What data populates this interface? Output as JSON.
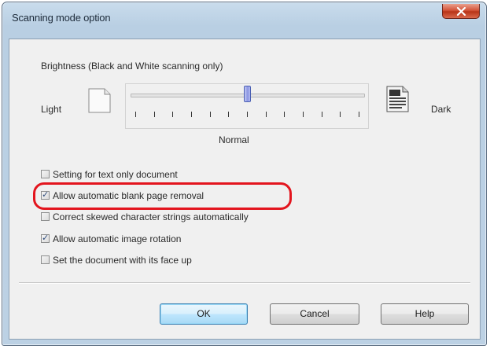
{
  "window": {
    "title": "Scanning mode option"
  },
  "brightness": {
    "title": "Brightness (Black and White scanning only)",
    "light_label": "Light",
    "dark_label": "Dark",
    "normal_label": "Normal",
    "slider_tick_count": 13,
    "slider_value_fraction": 0.5
  },
  "options": [
    {
      "label": "Setting for text only document",
      "checked": false
    },
    {
      "label": "Allow automatic blank page removal",
      "checked": true
    },
    {
      "label": "Correct skewed character strings automatically",
      "checked": false
    },
    {
      "label": "Allow automatic image rotation",
      "checked": true
    },
    {
      "label": "Set the document with its face up",
      "checked": false
    }
  ],
  "highlight_color": "#e3151e",
  "buttons": {
    "ok": "OK",
    "cancel": "Cancel",
    "help": "Help"
  }
}
